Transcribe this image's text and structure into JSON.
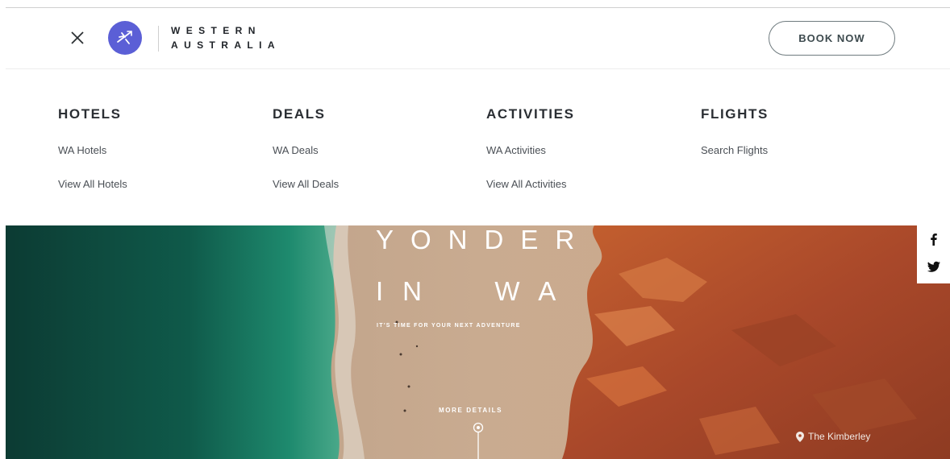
{
  "header": {
    "brand": {
      "line1": "WESTERN",
      "line2": "AUSTRALIA"
    },
    "book_label": "BOOK NOW"
  },
  "menu": {
    "columns": [
      {
        "title": "HOTELS",
        "links": [
          "WA Hotels",
          "View All Hotels"
        ]
      },
      {
        "title": "DEALS",
        "links": [
          "WA Deals",
          "View All Deals"
        ]
      },
      {
        "title": "ACTIVITIES",
        "links": [
          "WA Activities",
          "View All Activities"
        ]
      },
      {
        "title": "FLIGHTS",
        "links": [
          "Search Flights"
        ]
      }
    ]
  },
  "hero": {
    "title_line1": "YONDER",
    "title_line2": "IN  WA",
    "subtitle": "IT'S TIME FOR YOUR NEXT ADVENTURE",
    "more_label": "MORE DETAILS",
    "location": "The Kimberley"
  },
  "icons": {
    "close": "close-icon",
    "logo": "plane-icon",
    "facebook": "facebook-icon",
    "twitter": "twitter-icon",
    "location": "map-pin-icon"
  },
  "colors": {
    "brand_accent": "#5b5fd6",
    "ocean": "#0f5a4a",
    "sand": "#c7a88c",
    "rock": "#b5532b"
  }
}
